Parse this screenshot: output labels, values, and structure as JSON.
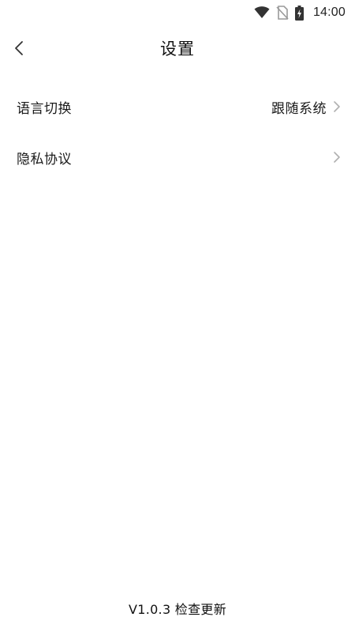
{
  "status_bar": {
    "time": "14:00",
    "icons": [
      "wifi-icon",
      "no-sim-icon",
      "battery-charging-icon"
    ]
  },
  "header": {
    "title": "设置",
    "back_icon": "chevron-left-icon"
  },
  "settings": [
    {
      "label": "语言切换",
      "value": "跟随系统"
    },
    {
      "label": "隐私协议",
      "value": ""
    }
  ],
  "footer": {
    "version_text": "V1.0.3 检查更新"
  },
  "colors": {
    "background": "#ffffff",
    "text": "#1a1a1a",
    "chevron": "#b0b0b0"
  }
}
